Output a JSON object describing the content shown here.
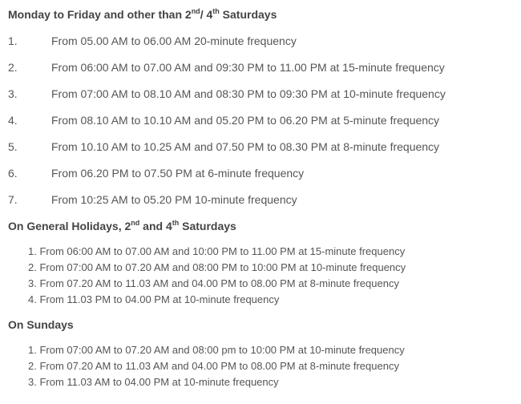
{
  "section1": {
    "heading_a": "Monday to Friday and other than 2",
    "heading_sup1": "nd",
    "heading_b": "/ 4",
    "heading_sup2": "th",
    "heading_c": " Saturdays",
    "items": [
      {
        "num": "1.",
        "text": "From 05.00 AM to 06.00 AM 20-minute frequency"
      },
      {
        "num": "2.",
        "text": "From 06:00 AM to 07.00 AM and 09:30 PM to 11.00 PM at 15-minute frequency"
      },
      {
        "num": "3.",
        "text": "From 07:00 AM to 08.10 AM and 08:30 PM to 09:30 PM at 10-minute frequency"
      },
      {
        "num": "4.",
        "text": "From 08.10 AM to 10.10 AM and 05.20 PM to 06.20 PM at 5-minute frequency"
      },
      {
        "num": "5.",
        "text": "From 10.10 AM to 10.25 AM and 07.50 PM to 08.30 PM at 8-minute frequency"
      },
      {
        "num": "6.",
        "text": "From 06.20 PM to 07.50 PM at 6-minute frequency"
      },
      {
        "num": "7.",
        "text": "From 10:25 AM to 05.20 PM 10-minute frequency"
      }
    ]
  },
  "section2": {
    "heading_a": "On General Holidays, 2",
    "heading_sup1": "nd",
    "heading_b": " and 4",
    "heading_sup2": "th",
    "heading_c": " Saturdays",
    "items": [
      "1. From 06:00 AM to 07.00 AM and 10:00 PM to 11.00 PM at 15-minute frequency",
      "2. From 07:00 AM to 07.20 AM and 08:00 PM to 10:00 PM at 10-minute frequency",
      "3. From 07.20 AM to 11.03 AM and 04.00 PM to 08.00 PM at 8-minute frequency",
      "4. From 11.03 PM to 04.00 PM at 10-minute frequency"
    ]
  },
  "section3": {
    "heading": "On Sundays",
    "items": [
      "1. From 07:00 AM to 07.20 AM and 08:00 pm to 10:00 PM at 10-minute frequency",
      "2. From 07.20 AM to 11.03 AM and 04.00 PM to 08.00 PM at 8-minute frequency",
      "3. From 11.03 AM to 04.00 PM at 10-minute frequency"
    ]
  }
}
